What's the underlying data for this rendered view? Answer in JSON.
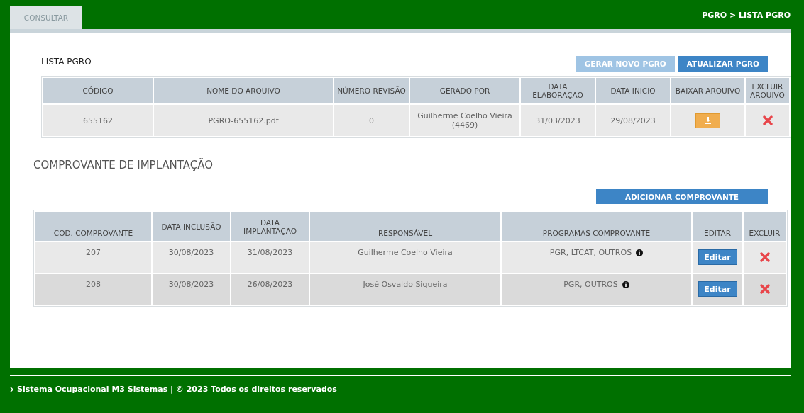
{
  "tabs": [
    {
      "label": "CONSULTAR",
      "selected": true
    }
  ],
  "breadcrumb": "PGRO > LISTA PGRO",
  "pgro_list": {
    "title": "LISTA PGRO",
    "buttons": [
      {
        "label": "GERAR NOVO PGRO",
        "disabled": true
      },
      {
        "label": "ATUALIZAR PGRO",
        "disabled": false
      }
    ],
    "columns": [
      "CÓDIGO",
      "NOME DO ARQUIVO",
      "NÚMERO REVISÃO",
      "GERADO POR",
      "DATA ELABORAÇÃO",
      "DATA INICIO",
      "BAIXAR ARQUIVO",
      "EXCLUIR ARQUIVO"
    ],
    "rows": [
      {
        "codigo": "655162",
        "arquivo": "PGRO-655162.pdf",
        "revisao": "0",
        "gerado_por": "Guilherme Coelho Vieira (4469)",
        "data_elaboracao": "31/03/2023",
        "data_inicio": "29/08/2023"
      }
    ]
  },
  "comprovantes": {
    "title": "COMPROVANTE DE IMPLANTAÇÃO",
    "add_button": "ADICIONAR COMPROVANTE",
    "columns": [
      "COD. COMPROVANTE",
      "DATA INCLUSÃO",
      "DATA IMPLANTAÇÃO",
      "RESPONSÁVEL",
      "PROGRAMAS COMPROVANTE",
      "EDITAR",
      "EXCLUIR"
    ],
    "rows": [
      {
        "codigo": "207",
        "data_inclusao": "30/08/2023",
        "data_implantacao": "31/08/2023",
        "responsavel": "Guilherme Coelho Vieira",
        "programas": "PGR, LTCAT, OUTROS",
        "edit_label": "Editar"
      },
      {
        "codigo": "208",
        "data_inclusao": "30/08/2023",
        "data_implantacao": "26/08/2023",
        "responsavel": "José Osvaldo Siqueira",
        "programas": "PGR, OUTROS",
        "edit_label": "Editar"
      }
    ]
  },
  "footer": "Sistema Ocupacional M3 Sistemas | © 2023 Todos os direitos reservados"
}
